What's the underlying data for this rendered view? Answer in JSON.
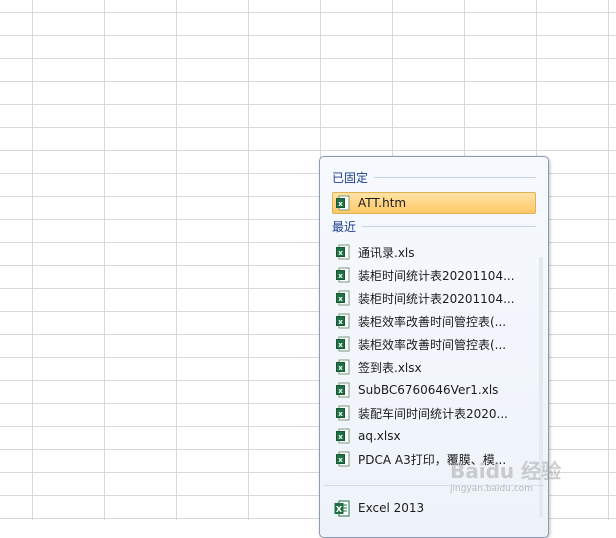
{
  "jumplist": {
    "pinned_header": "已固定",
    "pinned": [
      {
        "label": "ATT.htm",
        "icon": "excel-doc-icon"
      }
    ],
    "recent_header": "最近",
    "recent": [
      {
        "label": "通讯录.xls",
        "icon": "excel-doc-icon"
      },
      {
        "label": "装柜时间统计表20201104...",
        "icon": "excel-doc-icon"
      },
      {
        "label": "装柜时间统计表20201104...",
        "icon": "excel-doc-icon"
      },
      {
        "label": "装柜效率改善时间管控表(...",
        "icon": "excel-doc-icon"
      },
      {
        "label": "装柜效率改善时间管控表(...",
        "icon": "excel-doc-icon"
      },
      {
        "label": "签到表.xlsx",
        "icon": "excel-doc-icon"
      },
      {
        "label": "SubBC6760646Ver1.xls",
        "icon": "excel-doc-icon"
      },
      {
        "label": "装配车间时间统计表2020...",
        "icon": "excel-doc-icon"
      },
      {
        "label": "aq.xlsx",
        "icon": "excel-doc-icon"
      },
      {
        "label": "PDCA A3打印，覆膜、模...",
        "icon": "excel-doc-icon"
      }
    ],
    "app": {
      "label": "Excel 2013",
      "icon": "excel-app-icon"
    }
  },
  "watermark": {
    "text": "Baidu 经验",
    "sub": "jingyan.baidu.com"
  },
  "colors": {
    "header_text": "#1a3e8c",
    "pinned_highlight": "#ffc867",
    "excel_green": "#1e7145"
  }
}
